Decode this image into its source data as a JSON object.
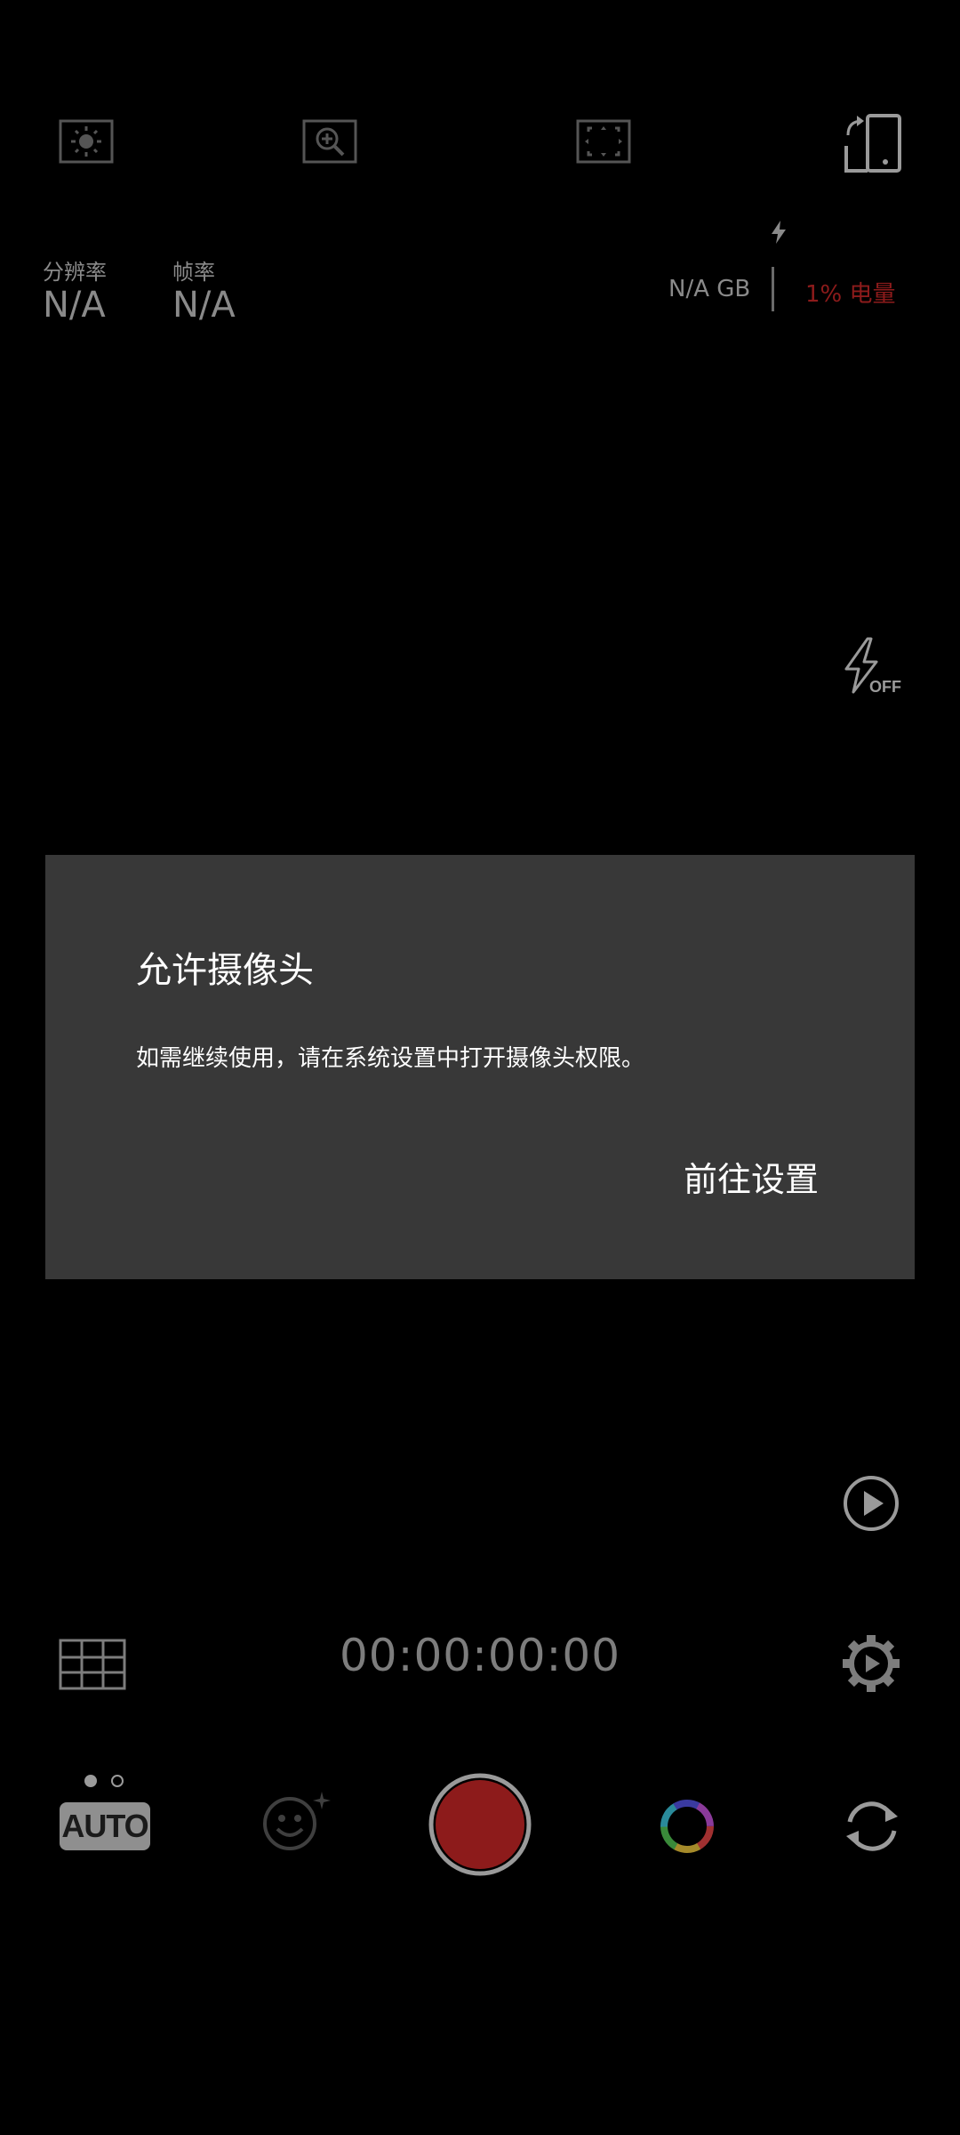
{
  "status": {
    "resolution_label": "分辨率",
    "resolution_value": "N/A",
    "framerate_label": "帧率",
    "framerate_value": "N/A",
    "storage": "N/A GB",
    "battery": "1% 电量"
  },
  "flash": {
    "state": "OFF"
  },
  "dialog": {
    "title": "允许摄像头",
    "message": "如需继续使用，请在系统设置中打开摄像头权限。",
    "button": "前往设置"
  },
  "recording": {
    "timer": "00:00:00:00"
  },
  "mode": {
    "label": "AUTO"
  },
  "colors": {
    "record_red": "#8d1b1b",
    "battery_red": "#8d1b1b",
    "dialog_bg": "#383838"
  }
}
